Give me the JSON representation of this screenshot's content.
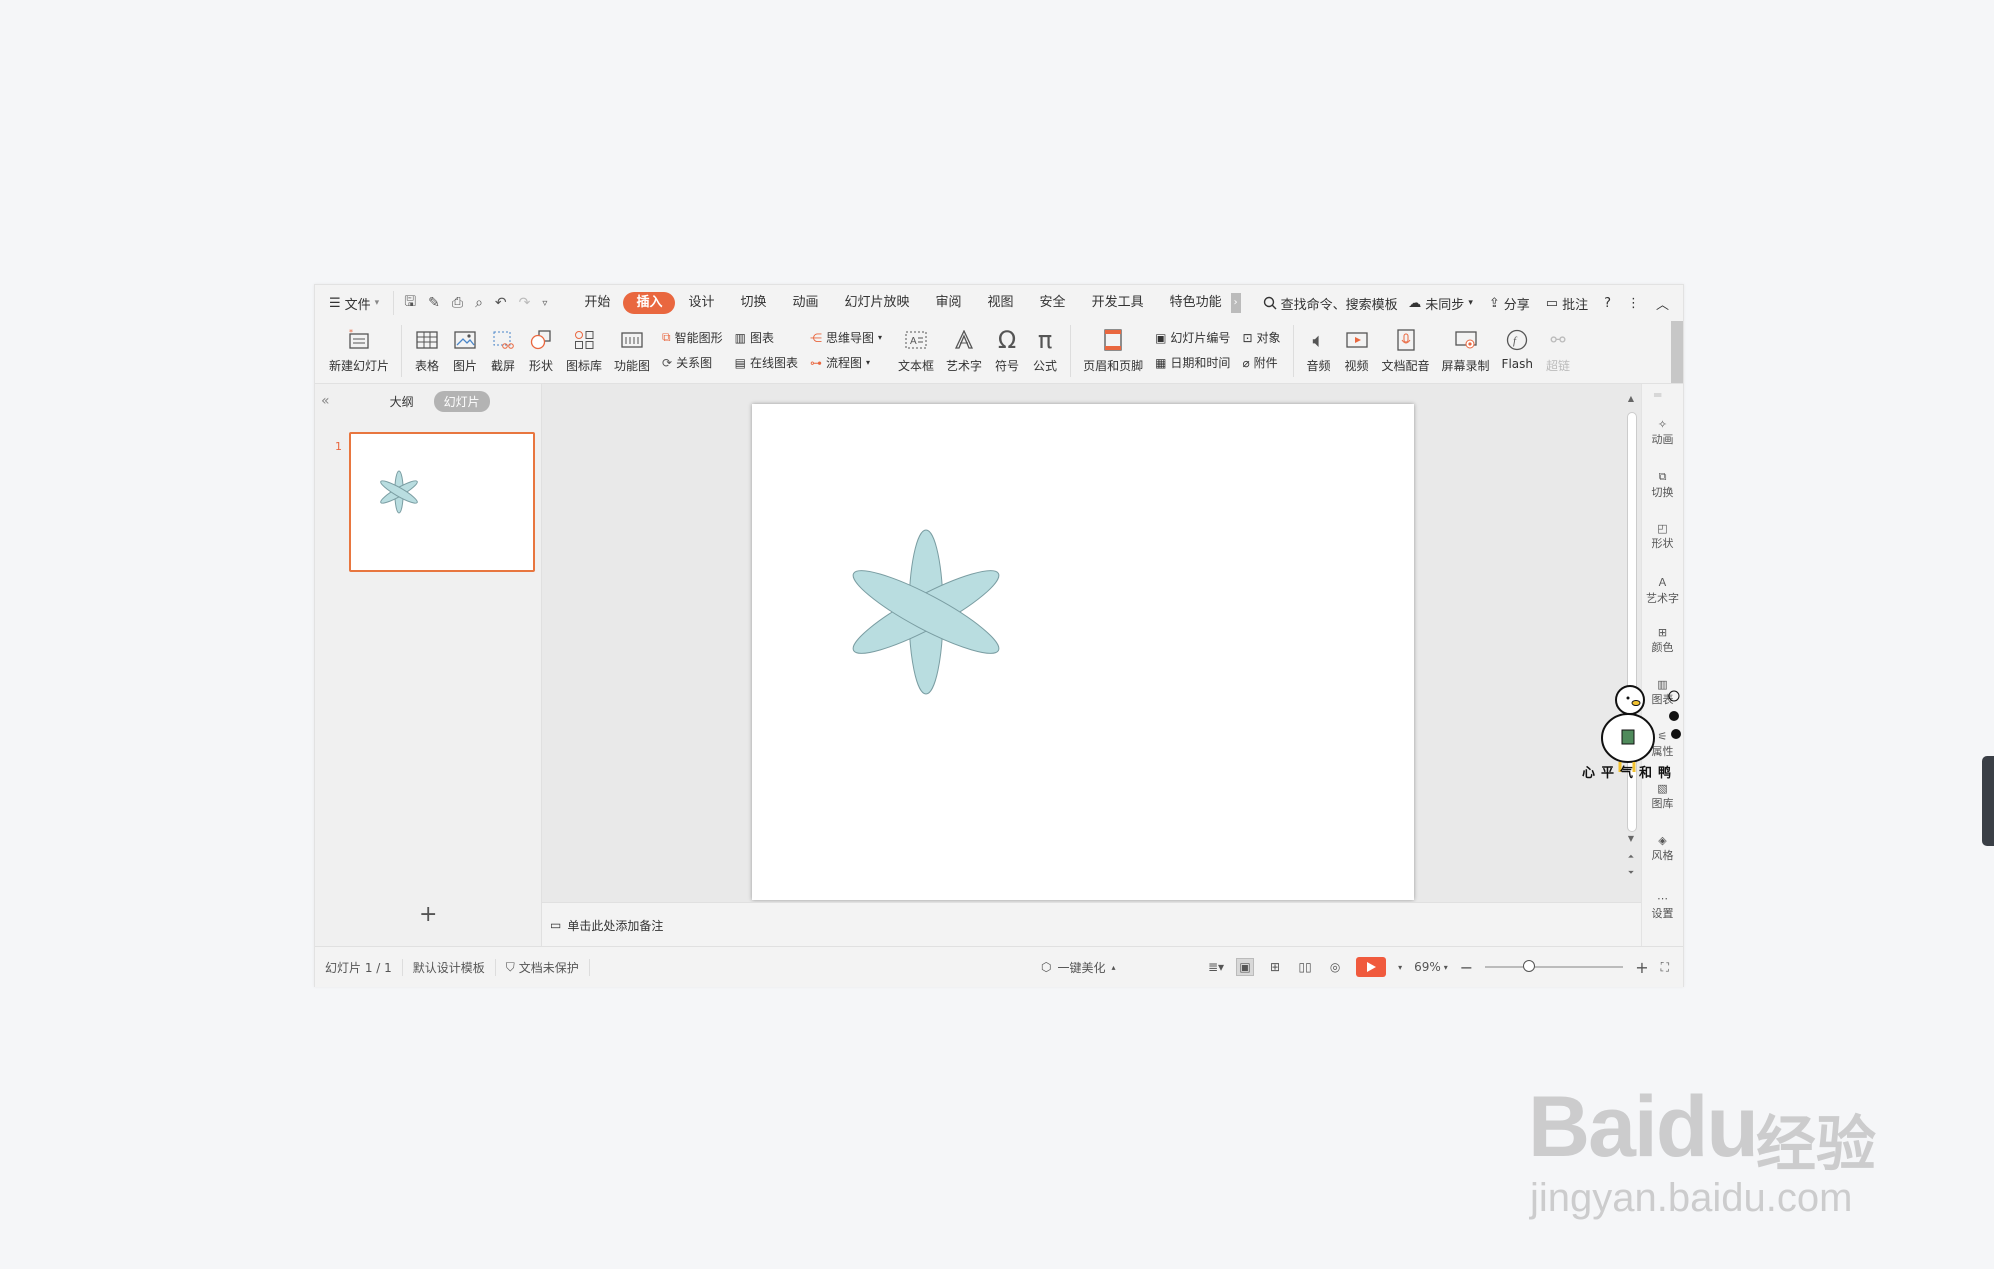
{
  "menubar": {
    "file_label": "文件",
    "tabs": [
      "开始",
      "插入",
      "设计",
      "切换",
      "动画",
      "幻灯片放映",
      "审阅",
      "视图",
      "安全",
      "开发工具",
      "特色功能"
    ],
    "active_tab": "插入",
    "search_label": "查找命令、搜索模板",
    "sync_label": "未同步",
    "share_label": "分享",
    "comment_label": "批注",
    "help_label": "?"
  },
  "ribbon": {
    "new_slide": "新建幻灯片",
    "table": "表格",
    "picture": "图片",
    "screenshot": "截屏",
    "shape": "形状",
    "icon_lib": "图标库",
    "function_chart": "功能图",
    "smart_graphic": "智能图形",
    "chart": "图表",
    "relation": "关系图",
    "online_chart": "在线图表",
    "mindmap": "思维导图",
    "flowchart": "流程图",
    "textbox": "文本框",
    "wordart": "艺术字",
    "symbol": "符号",
    "formula": "公式",
    "header_footer": "页眉和页脚",
    "slide_number": "幻灯片编号",
    "object": "对象",
    "datetime": "日期和时间",
    "attachment": "附件",
    "audio": "音频",
    "video": "视频",
    "doc_voice": "文档配音",
    "screen_record": "屏幕录制",
    "flash": "Flash",
    "hyperlink": "超链"
  },
  "leftpanel": {
    "outline_tab": "大纲",
    "slides_tab": "幻灯片",
    "slide_number": "1"
  },
  "notes": {
    "placeholder": "单击此处添加备注"
  },
  "sidepanel": {
    "items": [
      "动画",
      "切换",
      "形状",
      "艺术字",
      "颜色",
      "图表",
      "属性",
      "图库",
      "风格",
      "设置"
    ]
  },
  "statusbar": {
    "slide_info": "幻灯片 1 / 1",
    "template": "默认设计模板",
    "protection": "文档未保护",
    "beautify": "一键美化",
    "zoom": "69%"
  },
  "slide": {
    "petal_fill": "#b9dde0",
    "petal_stroke": "#7a9da2"
  },
  "overlays": {
    "sticker_text": "心平气和鸭",
    "watermark_main": "Baidu",
    "watermark_cn": "经验",
    "watermark_url": "jingyan.baidu.com"
  },
  "colors": {
    "accent": "#e9673f",
    "play": "#f05a3d"
  }
}
